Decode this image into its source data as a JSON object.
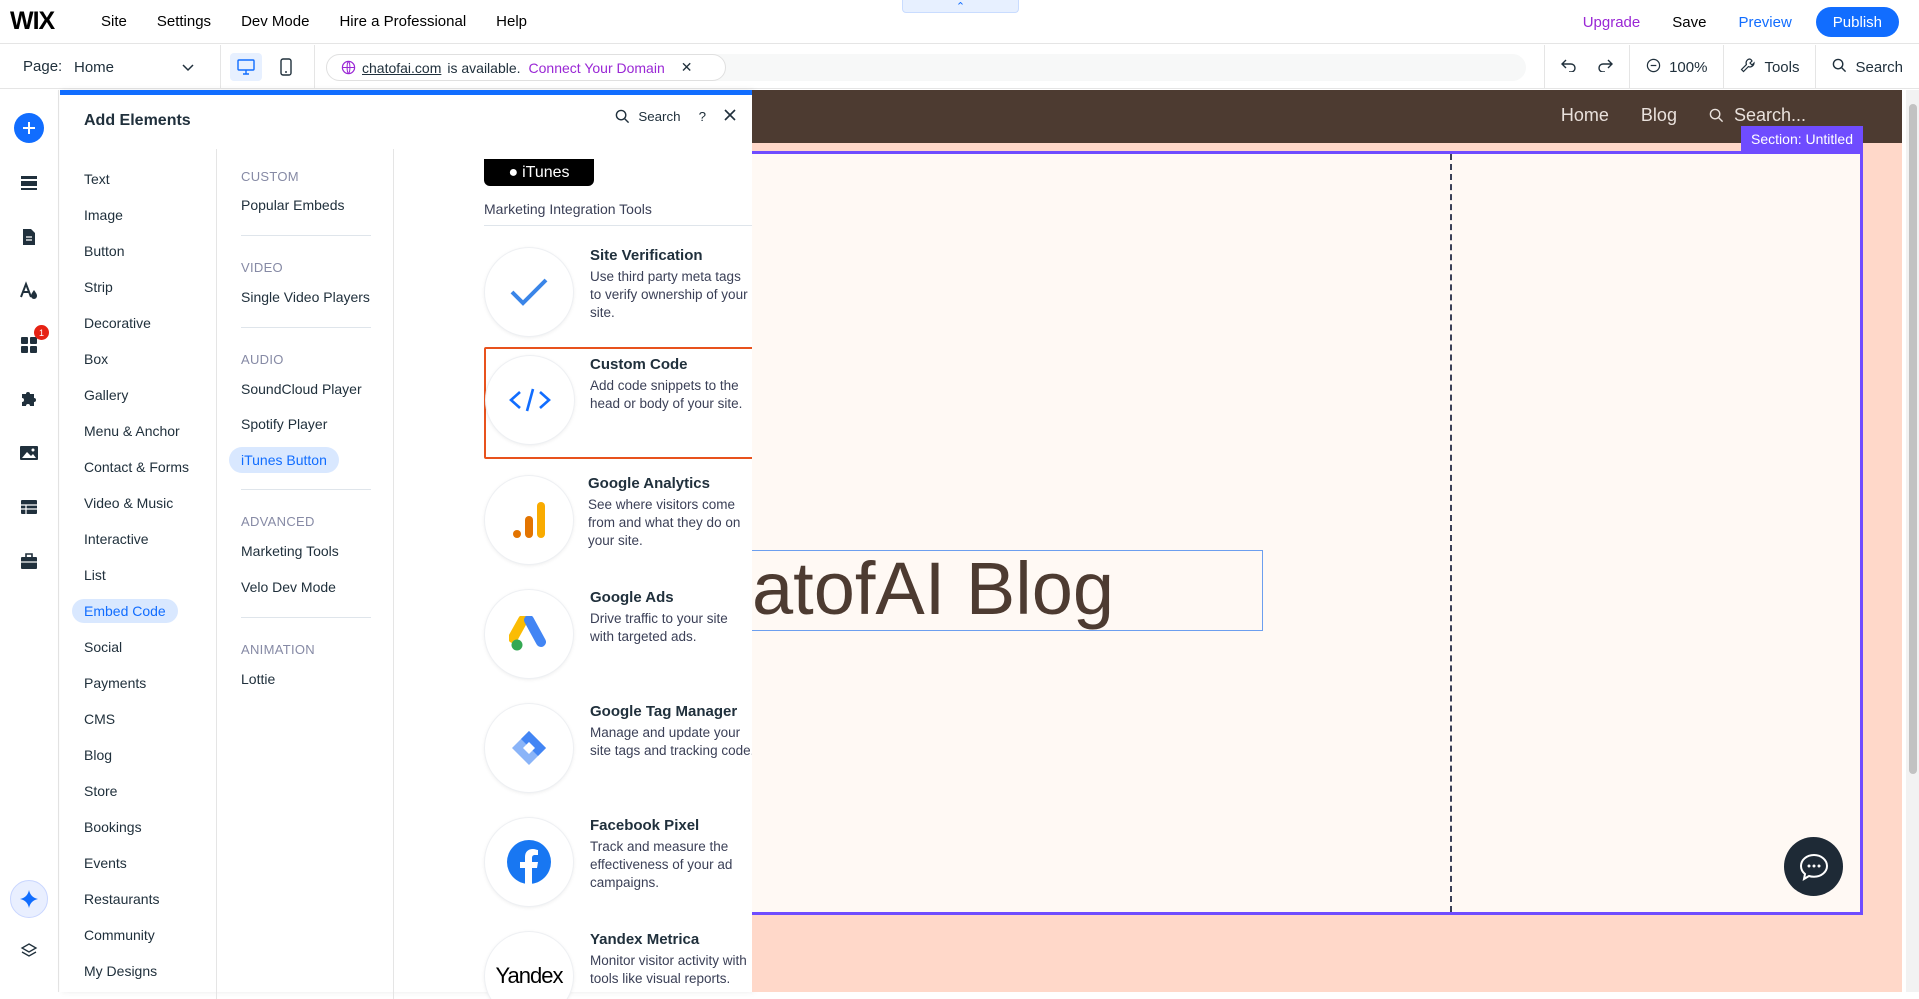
{
  "topbar": {
    "logo": "WIX",
    "menu": [
      "Site",
      "Settings",
      "Dev Mode",
      "Hire a Professional",
      "Help"
    ],
    "upgrade": "Upgrade",
    "save": "Save",
    "preview": "Preview",
    "publish": "Publish"
  },
  "bar2": {
    "page_label": "Page:",
    "page_value": "Home",
    "domain": "chatofai.com",
    "domain_status": "is available.",
    "connect": "Connect Your Domain",
    "zoom": "100%",
    "tools": "Tools",
    "search": "Search"
  },
  "rail": {
    "notification_count": "1"
  },
  "panel": {
    "title": "Add Elements",
    "search": "Search",
    "help": "?",
    "categories": [
      "Text",
      "Image",
      "Button",
      "Strip",
      "Decorative",
      "Box",
      "Gallery",
      "Menu & Anchor",
      "Contact & Forms",
      "Video & Music",
      "Interactive",
      "List",
      "Embed Code",
      "Social",
      "Payments",
      "CMS",
      "Blog",
      "Store",
      "Bookings",
      "Events",
      "Restaurants",
      "Community",
      "My Designs"
    ],
    "selected_category": "Embed Code",
    "groups": {
      "custom": {
        "label": "CUSTOM",
        "items": [
          "Popular Embeds"
        ]
      },
      "video": {
        "label": "VIDEO",
        "items": [
          "Single Video Players"
        ]
      },
      "audio": {
        "label": "AUDIO",
        "items": [
          "SoundCloud Player",
          "Spotify Player",
          "iTunes Button"
        ]
      },
      "advanced": {
        "label": "ADVANCED",
        "items": [
          "Marketing Tools",
          "Velo Dev Mode"
        ]
      },
      "animation": {
        "label": "ANIMATION",
        "items": [
          "Lottie"
        ]
      }
    },
    "itunes_badge": "iTunes",
    "section_title": "Marketing Integration Tools",
    "cards": [
      {
        "title": "Site Verification",
        "desc": "Use third party meta tags to verify ownership of your site."
      },
      {
        "title": "Custom Code",
        "desc": "Add code snippets to the head or body of your site."
      },
      {
        "title": "Google Analytics",
        "desc": "See where visitors come from and what they do on your site."
      },
      {
        "title": "Google Ads",
        "desc": "Drive traffic to your site with targeted ads."
      },
      {
        "title": "Google Tag Manager",
        "desc": "Manage and update your site tags and tracking code."
      },
      {
        "title": "Facebook Pixel",
        "desc": "Track and measure the effectiveness of your ad campaigns."
      },
      {
        "title": "Yandex Metrica",
        "desc": "Monitor visitor activity with tools like visual reports."
      }
    ],
    "yandex_logo": "Yandex"
  },
  "canvas": {
    "nav": [
      "Home",
      "Blog"
    ],
    "nav_search": "Search...",
    "section_label": "Section: Untitled",
    "blog_title": "atofAI Blog"
  },
  "colors": {
    "accent": "#116dff",
    "highlight": "#e8521d",
    "section": "#6f4cff",
    "header": "#4d3b31"
  }
}
